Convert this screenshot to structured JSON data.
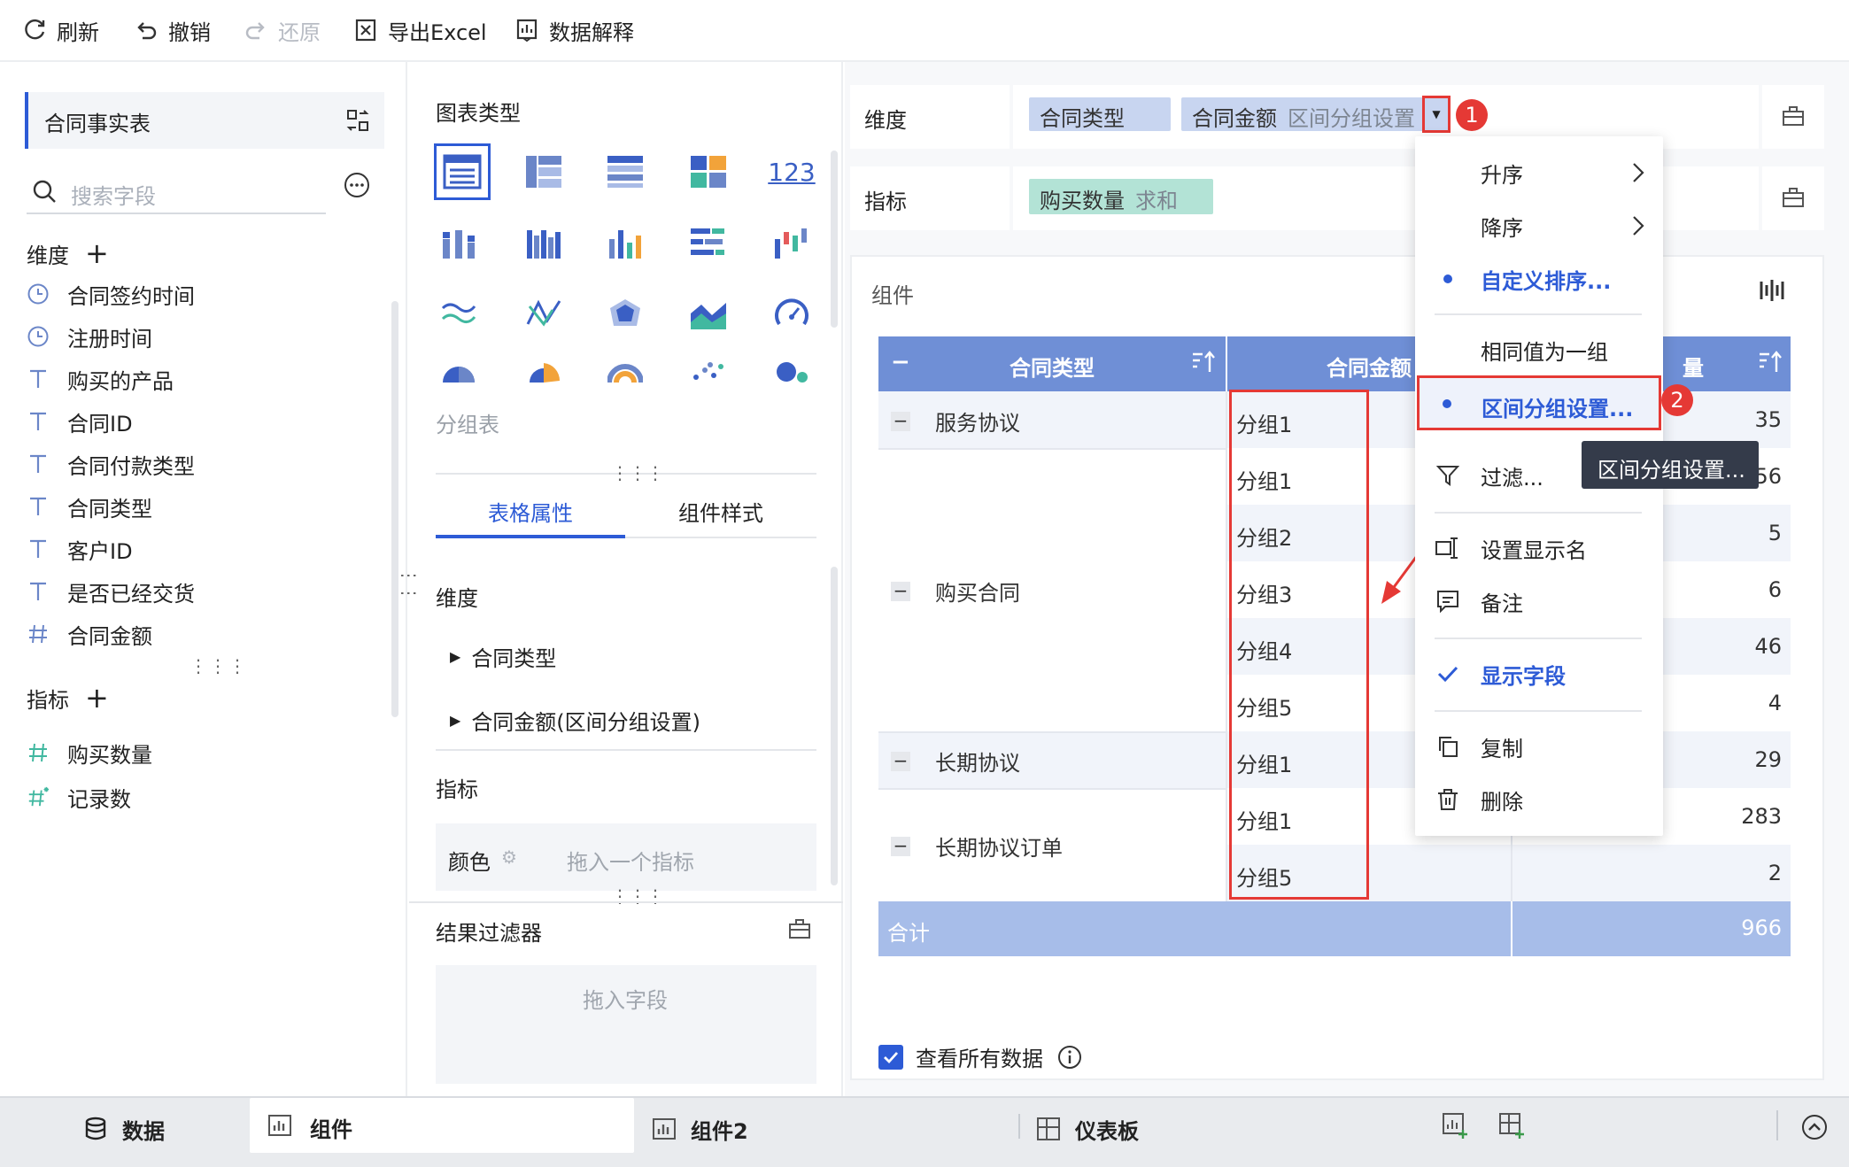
{
  "toolbar": {
    "refresh": "刷新",
    "undo": "撤销",
    "redo": "还原",
    "export": "导出Excel",
    "explain": "数据解释"
  },
  "left_panel": {
    "table_name": "合同事实表",
    "search_placeholder": "搜索字段",
    "dimension_header": "维度",
    "dimensions": [
      {
        "label": "合同签约时间",
        "icon": "clock-icon"
      },
      {
        "label": "注册时间",
        "icon": "clock-icon"
      },
      {
        "label": "购买的产品",
        "icon": "text-t-icon"
      },
      {
        "label": "合同ID",
        "icon": "text-t-icon"
      },
      {
        "label": "合同付款类型",
        "icon": "text-t-icon"
      },
      {
        "label": "合同类型",
        "icon": "text-t-icon"
      },
      {
        "label": "客户ID",
        "icon": "text-t-icon"
      },
      {
        "label": "是否已经交货",
        "icon": "text-t-icon"
      },
      {
        "label": "合同金额",
        "icon": "hash-icon"
      }
    ],
    "measure_header": "指标",
    "measures": [
      {
        "label": "购买数量",
        "icon": "hash-icon"
      },
      {
        "label": "记录数",
        "icon": "hash-star-icon"
      }
    ]
  },
  "middle_panel": {
    "chart_type_title": "图表类型",
    "chart_type_selected_label": "分组表",
    "tab_table_attr": "表格属性",
    "tab_component_style": "组件样式",
    "dimension_section": "维度",
    "dimension_items": [
      "合同类型",
      "合同金额(区间分组设置)"
    ],
    "measure_section": "指标",
    "color_label": "颜色",
    "color_placeholder": "拖入一个指标",
    "result_filter": "结果过滤器",
    "drag_field": "拖入字段"
  },
  "right_panel": {
    "dimension_label": "维度",
    "dimension_chip1": "合同类型",
    "dimension_chip2_name": "合同金额",
    "dimension_chip2_sub": "区间分组设置",
    "measure_label": "指标",
    "measure_chip_name": "购买数量",
    "measure_chip_sub": "求和",
    "component_title": "组件",
    "table": {
      "headers": [
        "合同类型",
        "合同金额",
        "量"
      ],
      "rows": [
        {
          "type": "服务协议",
          "group": "分组1",
          "value": "35"
        },
        {
          "type": "",
          "group": "分组1",
          "value": "56"
        },
        {
          "type": "",
          "group": "分组2",
          "value": "5"
        },
        {
          "type": "购买合同",
          "group": "分组3",
          "value": "6"
        },
        {
          "type": "",
          "group": "分组4",
          "value": "46"
        },
        {
          "type": "",
          "group": "分组5",
          "value": "4"
        },
        {
          "type": "长期协议",
          "group": "分组1",
          "value": "29"
        },
        {
          "type": "",
          "group": "分组1",
          "value": "283"
        },
        {
          "type": "长期协议订单",
          "group": "分组5",
          "value": "2"
        }
      ],
      "total_label": "合计",
      "total_value": "966"
    },
    "view_all_data": "查看所有数据"
  },
  "context_menu": {
    "items": [
      "升序",
      "降序",
      "自定义排序...",
      "相同值为一组",
      "区间分组设置...",
      "过滤...",
      "设置显示名",
      "备注",
      "显示字段",
      "复制",
      "删除"
    ],
    "tooltip": "区间分组设置..."
  },
  "annotations": {
    "badge1": "1",
    "badge2": "2"
  },
  "bottom_tabs": {
    "data": "数据",
    "component": "组件",
    "component2": "组件2",
    "dashboard": "仪表板"
  },
  "colors": {
    "header_blue": "#6f8fd6",
    "total_blue": "#a7bde9",
    "chip_blue": "#c8d5f0",
    "chip_green": "#b3e3d6",
    "accent": "#2d5bd6",
    "annotation_red": "#e53935"
  }
}
